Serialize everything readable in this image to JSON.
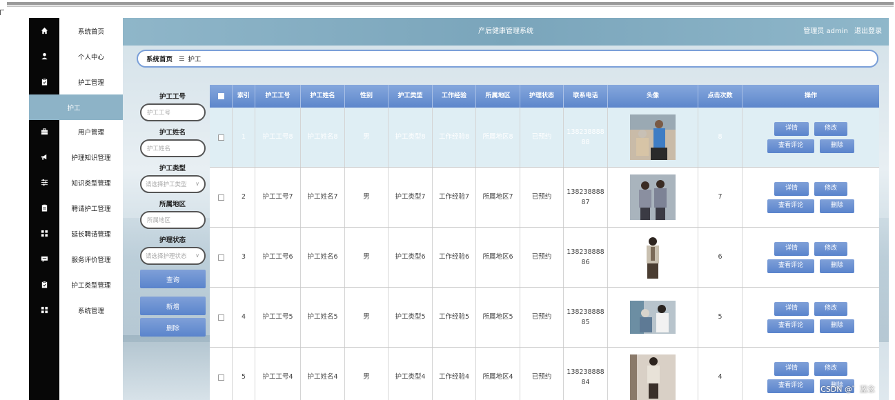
{
  "app": {
    "title": "产后健康管理系统",
    "user_role": "管理员 admin",
    "logout": "退出登录"
  },
  "sidebar": {
    "items": [
      {
        "label": "系统首页",
        "icon": "home-icon"
      },
      {
        "label": "个人中心",
        "icon": "user-icon"
      },
      {
        "label": "护工管理",
        "icon": "clipboard-icon"
      },
      {
        "label": "护工",
        "icon": "",
        "active": true
      },
      {
        "label": "用户管理",
        "icon": "briefcase-icon"
      },
      {
        "label": "护理知识管理",
        "icon": "megaphone-icon"
      },
      {
        "label": "知识类型管理",
        "icon": "sliders-icon"
      },
      {
        "label": "聘请护工管理",
        "icon": "document-icon"
      },
      {
        "label": "延长聘请管理",
        "icon": "grid-icon"
      },
      {
        "label": "服务评价管理",
        "icon": "comment-icon"
      },
      {
        "label": "护工类型管理",
        "icon": "clipboard-check-icon"
      },
      {
        "label": "系统管理",
        "icon": "grid-icon"
      }
    ]
  },
  "breadcrumb": {
    "home": "系统首页",
    "sep": "☰",
    "current": "护工"
  },
  "search": {
    "worker_no_label": "护工工号",
    "worker_no_placeholder": "护工工号",
    "worker_name_label": "护工姓名",
    "worker_name_placeholder": "护工姓名",
    "worker_type_label": "护工类型",
    "worker_type_placeholder": "请选择护工类型",
    "region_label": "所属地区",
    "region_placeholder": "所属地区",
    "status_label": "护理状态",
    "status_placeholder": "请选择护理状态",
    "query_button": "查询",
    "add_button": "新增",
    "delete_button": "删除"
  },
  "table": {
    "headers": [
      "索引",
      "护工工号",
      "护工姓名",
      "性别",
      "护工类型",
      "工作经验",
      "所属地区",
      "护理状态",
      "联系电话",
      "头像",
      "点击次数",
      "操作"
    ],
    "rows": [
      {
        "index": "1",
        "no": "护工工号8",
        "name": "护工姓名8",
        "gender": "男",
        "type": "护工类型8",
        "exp": "工作经验8",
        "region": "所属地区8",
        "status": "已预约",
        "phone1": "138238888",
        "phone2": "88",
        "clicks": "8"
      },
      {
        "index": "2",
        "no": "护工工号7",
        "name": "护工姓名7",
        "gender": "男",
        "type": "护工类型7",
        "exp": "工作经验7",
        "region": "所属地区7",
        "status": "已预约",
        "phone1": "138238888",
        "phone2": "87",
        "clicks": "7"
      },
      {
        "index": "3",
        "no": "护工工号6",
        "name": "护工姓名6",
        "gender": "男",
        "type": "护工类型6",
        "exp": "工作经验6",
        "region": "所属地区6",
        "status": "已预约",
        "phone1": "138238888",
        "phone2": "86",
        "clicks": "6"
      },
      {
        "index": "4",
        "no": "护工工号5",
        "name": "护工姓名5",
        "gender": "男",
        "type": "护工类型5",
        "exp": "工作经验5",
        "region": "所属地区5",
        "status": "已预约",
        "phone1": "138238888",
        "phone2": "85",
        "clicks": "5"
      },
      {
        "index": "5",
        "no": "护工工号4",
        "name": "护工姓名4",
        "gender": "男",
        "type": "护工类型4",
        "exp": "工作经验4",
        "region": "所属地区4",
        "status": "已预约",
        "phone1": "138238888",
        "phone2": "84",
        "clicks": "4"
      }
    ],
    "actions": {
      "detail": "详情",
      "edit": "修改",
      "comments": "查看评论",
      "delete": "删除"
    }
  },
  "watermark": "CSDN @゛蓝念",
  "colors": {
    "accent": "#5d86cb",
    "header": "#84adc2",
    "sidebar_dark": "#070707",
    "active_nav": "#8db3c7"
  }
}
